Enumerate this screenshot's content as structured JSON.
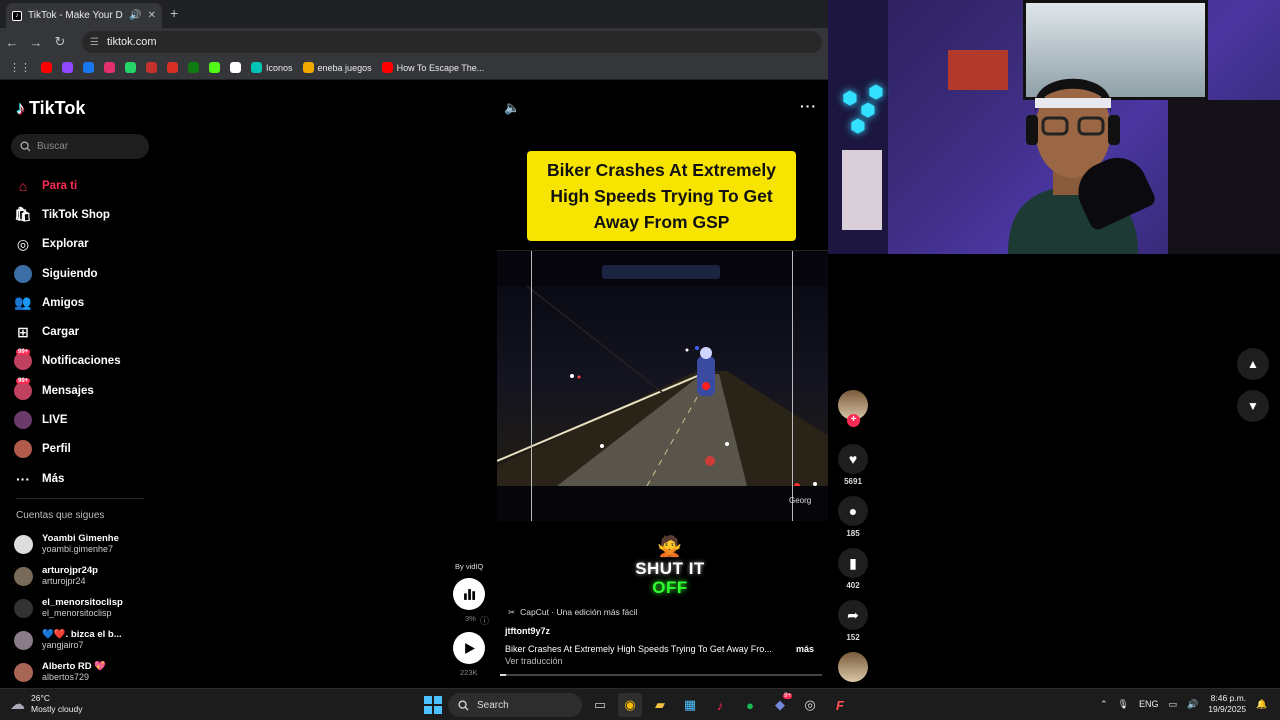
{
  "browser": {
    "tab_title": "TikTok - Make Your Day",
    "url": "tiktok.com",
    "bookmarks": [
      {
        "label": "",
        "color": "#ff0000"
      },
      {
        "label": "",
        "color": "#9146ff"
      },
      {
        "label": "",
        "color": "#1877f2"
      },
      {
        "label": "",
        "color": "#e1306c"
      },
      {
        "label": "",
        "color": "#25d366"
      },
      {
        "label": "",
        "color": "#c4302b"
      },
      {
        "label": "",
        "color": "#d93025"
      },
      {
        "label": "",
        "color": "#107c10"
      },
      {
        "label": "",
        "color": "#53fc18"
      },
      {
        "label": "",
        "color": "#ffffff"
      },
      {
        "label": "Iconos",
        "color": "#00c4b4"
      },
      {
        "label": "eneba juegos",
        "color": "#f2a900"
      },
      {
        "label": "How To Escape The...",
        "color": "#ff0000"
      }
    ]
  },
  "sidebar": {
    "logo": "TikTok",
    "search_placeholder": "Buscar",
    "nav": [
      {
        "label": "Para ti",
        "icon": "home-icon",
        "active": true
      },
      {
        "label": "TikTok Shop",
        "icon": "shop-icon"
      },
      {
        "label": "Explorar",
        "icon": "compass-icon"
      },
      {
        "label": "Siguiendo",
        "icon": "avatar"
      },
      {
        "label": "Amigos",
        "icon": "friends-icon"
      },
      {
        "label": "Cargar",
        "icon": "upload-icon"
      },
      {
        "label": "Notificaciones",
        "icon": "bell-icon",
        "badge": "99+"
      },
      {
        "label": "Mensajes",
        "icon": "message-icon",
        "badge": "99+"
      },
      {
        "label": "LIVE",
        "icon": "live-icon"
      },
      {
        "label": "Perfil",
        "icon": "profile-icon"
      },
      {
        "label": "Más",
        "icon": "more-icon"
      }
    ],
    "following_title": "Cuentas que sigues",
    "following": [
      {
        "name": "Yoambi Gimenhe",
        "handle": "yoambi.gimenhe7",
        "color": "#dddddd"
      },
      {
        "name": "arturojpr24p",
        "handle": "arturojpr24",
        "color": "#7a6a5a"
      },
      {
        "name": "el_menorsitoclisp",
        "handle": "el_menorsitoclisp",
        "color": "#333333"
      },
      {
        "name": "💙❤️. bizca el b...",
        "handle": "yangjairo7",
        "color": "#8a7a8a"
      },
      {
        "name": "Alberto RD 💖",
        "handle": "albertos729",
        "color": "#aa6655"
      }
    ]
  },
  "video": {
    "headline": "Biker Crashes At Extremely High Speeds Trying To Get Away From GSP",
    "watermark": "Georg",
    "credit": "By vidIQ",
    "overlay_line1": "SHUT IT",
    "overlay_line2": "OFF",
    "stats_pct": "3%",
    "views": "223K",
    "capcut": "CapCut · Una edición más fácil",
    "author": "jtftont9y7z",
    "description": "Biker Crashes At Extremely High Speeds Trying To Get Away Fro...",
    "more": "más",
    "translate": "Ver traducción",
    "progress": 0.02
  },
  "actions": {
    "likes": "5691",
    "comments": "185",
    "saves": "402",
    "shares": "152"
  },
  "taskbar": {
    "temp": "26°C",
    "weather": "Mostly cloudy",
    "search": "Search",
    "lang": "ENG",
    "time": "8:46 p.m.",
    "date": "19/9/2025",
    "badge": "9+"
  }
}
